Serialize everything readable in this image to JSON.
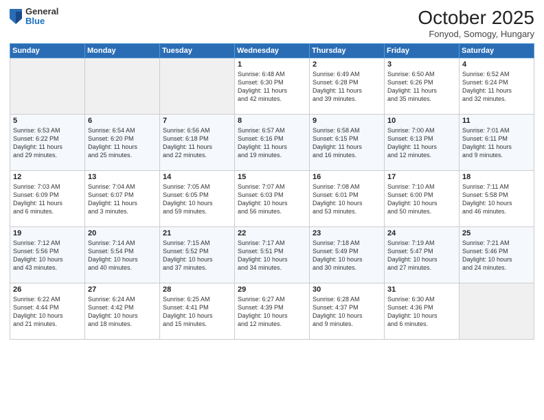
{
  "logo": {
    "general": "General",
    "blue": "Blue"
  },
  "header": {
    "month_title": "October 2025",
    "subtitle": "Fonyod, Somogy, Hungary"
  },
  "weekdays": [
    "Sunday",
    "Monday",
    "Tuesday",
    "Wednesday",
    "Thursday",
    "Friday",
    "Saturday"
  ],
  "weeks": [
    [
      {
        "day": "",
        "info": ""
      },
      {
        "day": "",
        "info": ""
      },
      {
        "day": "",
        "info": ""
      },
      {
        "day": "1",
        "info": "Sunrise: 6:48 AM\nSunset: 6:30 PM\nDaylight: 11 hours\nand 42 minutes."
      },
      {
        "day": "2",
        "info": "Sunrise: 6:49 AM\nSunset: 6:28 PM\nDaylight: 11 hours\nand 39 minutes."
      },
      {
        "day": "3",
        "info": "Sunrise: 6:50 AM\nSunset: 6:26 PM\nDaylight: 11 hours\nand 35 minutes."
      },
      {
        "day": "4",
        "info": "Sunrise: 6:52 AM\nSunset: 6:24 PM\nDaylight: 11 hours\nand 32 minutes."
      }
    ],
    [
      {
        "day": "5",
        "info": "Sunrise: 6:53 AM\nSunset: 6:22 PM\nDaylight: 11 hours\nand 29 minutes."
      },
      {
        "day": "6",
        "info": "Sunrise: 6:54 AM\nSunset: 6:20 PM\nDaylight: 11 hours\nand 25 minutes."
      },
      {
        "day": "7",
        "info": "Sunrise: 6:56 AM\nSunset: 6:18 PM\nDaylight: 11 hours\nand 22 minutes."
      },
      {
        "day": "8",
        "info": "Sunrise: 6:57 AM\nSunset: 6:16 PM\nDaylight: 11 hours\nand 19 minutes."
      },
      {
        "day": "9",
        "info": "Sunrise: 6:58 AM\nSunset: 6:15 PM\nDaylight: 11 hours\nand 16 minutes."
      },
      {
        "day": "10",
        "info": "Sunrise: 7:00 AM\nSunset: 6:13 PM\nDaylight: 11 hours\nand 12 minutes."
      },
      {
        "day": "11",
        "info": "Sunrise: 7:01 AM\nSunset: 6:11 PM\nDaylight: 11 hours\nand 9 minutes."
      }
    ],
    [
      {
        "day": "12",
        "info": "Sunrise: 7:03 AM\nSunset: 6:09 PM\nDaylight: 11 hours\nand 6 minutes."
      },
      {
        "day": "13",
        "info": "Sunrise: 7:04 AM\nSunset: 6:07 PM\nDaylight: 11 hours\nand 3 minutes."
      },
      {
        "day": "14",
        "info": "Sunrise: 7:05 AM\nSunset: 6:05 PM\nDaylight: 10 hours\nand 59 minutes."
      },
      {
        "day": "15",
        "info": "Sunrise: 7:07 AM\nSunset: 6:03 PM\nDaylight: 10 hours\nand 56 minutes."
      },
      {
        "day": "16",
        "info": "Sunrise: 7:08 AM\nSunset: 6:01 PM\nDaylight: 10 hours\nand 53 minutes."
      },
      {
        "day": "17",
        "info": "Sunrise: 7:10 AM\nSunset: 6:00 PM\nDaylight: 10 hours\nand 50 minutes."
      },
      {
        "day": "18",
        "info": "Sunrise: 7:11 AM\nSunset: 5:58 PM\nDaylight: 10 hours\nand 46 minutes."
      }
    ],
    [
      {
        "day": "19",
        "info": "Sunrise: 7:12 AM\nSunset: 5:56 PM\nDaylight: 10 hours\nand 43 minutes."
      },
      {
        "day": "20",
        "info": "Sunrise: 7:14 AM\nSunset: 5:54 PM\nDaylight: 10 hours\nand 40 minutes."
      },
      {
        "day": "21",
        "info": "Sunrise: 7:15 AM\nSunset: 5:52 PM\nDaylight: 10 hours\nand 37 minutes."
      },
      {
        "day": "22",
        "info": "Sunrise: 7:17 AM\nSunset: 5:51 PM\nDaylight: 10 hours\nand 34 minutes."
      },
      {
        "day": "23",
        "info": "Sunrise: 7:18 AM\nSunset: 5:49 PM\nDaylight: 10 hours\nand 30 minutes."
      },
      {
        "day": "24",
        "info": "Sunrise: 7:19 AM\nSunset: 5:47 PM\nDaylight: 10 hours\nand 27 minutes."
      },
      {
        "day": "25",
        "info": "Sunrise: 7:21 AM\nSunset: 5:46 PM\nDaylight: 10 hours\nand 24 minutes."
      }
    ],
    [
      {
        "day": "26",
        "info": "Sunrise: 6:22 AM\nSunset: 4:44 PM\nDaylight: 10 hours\nand 21 minutes."
      },
      {
        "day": "27",
        "info": "Sunrise: 6:24 AM\nSunset: 4:42 PM\nDaylight: 10 hours\nand 18 minutes."
      },
      {
        "day": "28",
        "info": "Sunrise: 6:25 AM\nSunset: 4:41 PM\nDaylight: 10 hours\nand 15 minutes."
      },
      {
        "day": "29",
        "info": "Sunrise: 6:27 AM\nSunset: 4:39 PM\nDaylight: 10 hours\nand 12 minutes."
      },
      {
        "day": "30",
        "info": "Sunrise: 6:28 AM\nSunset: 4:37 PM\nDaylight: 10 hours\nand 9 minutes."
      },
      {
        "day": "31",
        "info": "Sunrise: 6:30 AM\nSunset: 4:36 PM\nDaylight: 10 hours\nand 6 minutes."
      },
      {
        "day": "",
        "info": ""
      }
    ]
  ]
}
